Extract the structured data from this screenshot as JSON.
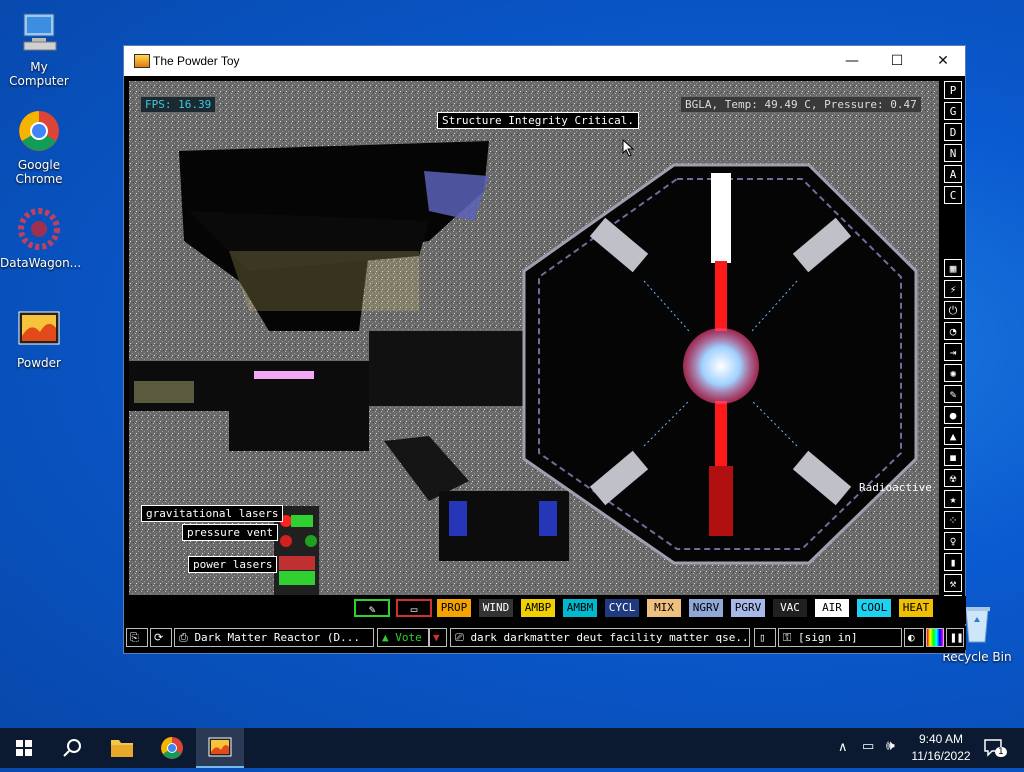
{
  "desktop": {
    "icons": [
      {
        "label": "My Computer"
      },
      {
        "label": "Google Chrome"
      },
      {
        "label": "DataWagon..."
      },
      {
        "label": "Powder"
      },
      {
        "label": "Recycle Bin"
      }
    ]
  },
  "window": {
    "title": "The Powder Toy",
    "minimize": "—",
    "maximize": "☐",
    "close": "✕"
  },
  "hud": {
    "fps": "FPS: 16.39",
    "status": "BGLA, Temp: 49.49 C, Pressure: 0.47",
    "message": "Structure Integrity Critical."
  },
  "scene_labels": {
    "gravitational_lasers": "gravitational lasers",
    "pressure_vent": "pressure vent",
    "power_lasers": "power lasers",
    "radioactive": "Radioactive"
  },
  "right_menu": [
    "P",
    "G",
    "D",
    "N",
    "A",
    "C"
  ],
  "tool_buttons": [
    {
      "label": "PROP",
      "bg": "#f5a300",
      "fg": "#000"
    },
    {
      "label": "WIND",
      "bg": "#333333",
      "fg": "#fff"
    },
    {
      "label": "AMBP",
      "bg": "#f0d000",
      "fg": "#000"
    },
    {
      "label": "AMBM",
      "bg": "#00b8d0",
      "fg": "#000"
    },
    {
      "label": "CYCL",
      "bg": "#203a80",
      "fg": "#fff"
    },
    {
      "label": "MIX",
      "bg": "#f0c080",
      "fg": "#000"
    },
    {
      "label": "NGRV",
      "bg": "#8fa8d8",
      "fg": "#000"
    },
    {
      "label": "PGRV",
      "bg": "#a8b8e8",
      "fg": "#000"
    },
    {
      "label": "VAC",
      "bg": "#202020",
      "fg": "#fff"
    },
    {
      "label": "AIR",
      "bg": "#ffffff",
      "fg": "#000"
    },
    {
      "label": "COOL",
      "bg": "#20d0f0",
      "fg": "#000"
    },
    {
      "label": "HEAT",
      "bg": "#f0c000",
      "fg": "#000"
    }
  ],
  "bottom_bar": {
    "save_name": "Dark Matter Reactor (D...",
    "vote": "Vote",
    "tags": "dark darkmatter deut facility matter qse...",
    "sign_in": "[sign in]"
  },
  "taskbar": {
    "time": "9:40 AM",
    "date": "11/16/2022",
    "notifications": "1"
  }
}
